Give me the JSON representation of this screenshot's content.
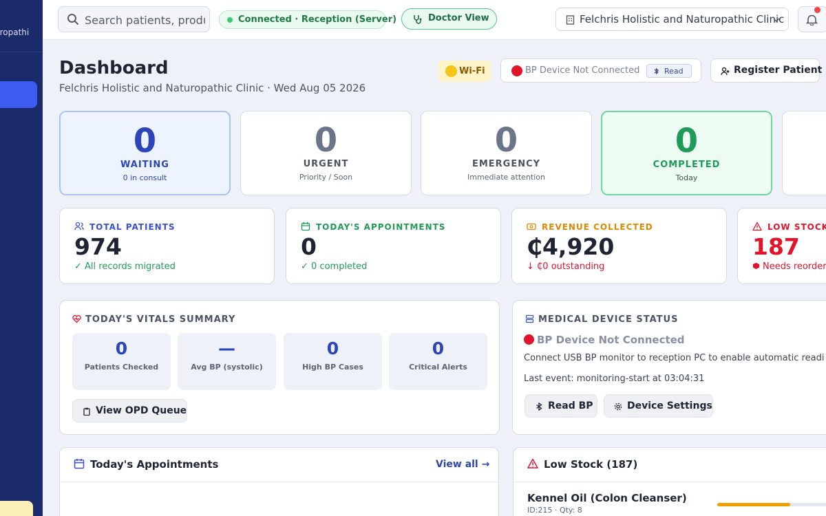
{
  "sidebar": {
    "brand_text": "uropathi"
  },
  "topbar": {
    "search_placeholder": "Search patients, produ",
    "connection": "Connected · Reception (Server)",
    "doctor_view": "Doctor View",
    "clinic": "Felchris Holistic and Naturopathic Clinic"
  },
  "header": {
    "title": "Dashboard",
    "subtitle": "Felchris Holistic and Naturopathic Clinic · Wed Aug 05 2026",
    "wifi": "Wi-Fi",
    "bp_status": "BP Device Not Connected",
    "read": "Read",
    "register": "Register Patient"
  },
  "queue": [
    {
      "value": "0",
      "label": "WAITING",
      "sub": "0 in consult"
    },
    {
      "value": "0",
      "label": "URGENT",
      "sub": "Priority / Soon"
    },
    {
      "value": "0",
      "label": "EMERGENCY",
      "sub": "Immediate attention"
    },
    {
      "value": "0",
      "label": "COMPLETED",
      "sub": "Today"
    }
  ],
  "stats": [
    {
      "label": "TOTAL PATIENTS",
      "value": "974",
      "foot": "✓  All records migrated",
      "color": "#3b4fd1",
      "foot_color": "#1f9a58"
    },
    {
      "label": "TODAY'S APPOINTMENTS",
      "value": "0",
      "foot": "✓  0 completed",
      "color": "#1f9a58",
      "foot_color": "#1f9a58"
    },
    {
      "label": "REVENUE COLLECTED",
      "value": "₵4,920",
      "foot": "↓  ₵0 outstanding",
      "color": "#d98a00",
      "foot_color": "#e0142b"
    },
    {
      "label": "LOW STOCK",
      "value": "187",
      "foot": "Needs reorder",
      "color": "#e0142b",
      "foot_color": "#e0142b"
    }
  ],
  "vitals": {
    "title": "TODAY'S VITALS SUMMARY",
    "items": [
      {
        "value": "0",
        "label": "Patients Checked"
      },
      {
        "value": "—",
        "label": "Avg BP (systolic)"
      },
      {
        "value": "0",
        "label": "High BP Cases"
      },
      {
        "value": "0",
        "label": "Critical Alerts"
      }
    ],
    "button": "View OPD Queue"
  },
  "device": {
    "title": "MEDICAL DEVICE STATUS",
    "status": "BP Device Not Connected",
    "desc": "Connect USB BP monitor to reception PC to enable automatic readi",
    "event": "Last event: monitoring-start at 03:04:31",
    "read_button": "Read BP",
    "settings_button": "Device Settings"
  },
  "appointments": {
    "title": "Today's Appointments",
    "view_all": "View all →"
  },
  "low_stock": {
    "title": "Low Stock (187)",
    "items": [
      {
        "name": "Kennel Oil (Colon Cleanser)",
        "meta": "ID:215 · Qty: 8",
        "level": 0.53
      }
    ]
  },
  "colors": {
    "accent": "#2c45b8",
    "sidebar": "#1b2a6b",
    "success": "#1f9a58",
    "danger": "#e0142b",
    "warning": "#d98a00"
  }
}
